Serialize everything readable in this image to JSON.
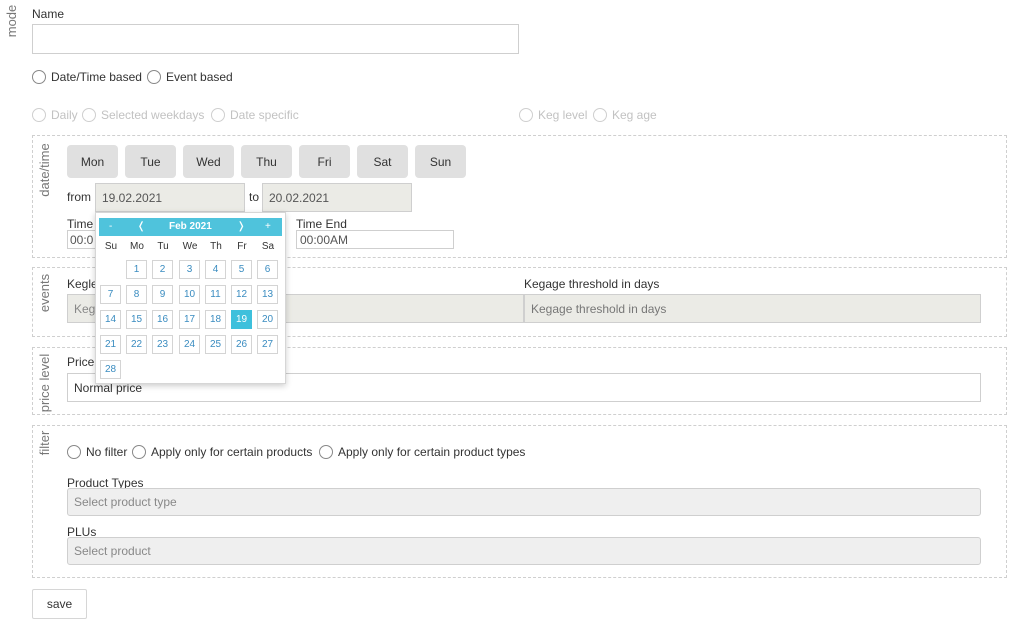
{
  "mode_label": "mode",
  "name": {
    "label": "Name",
    "value": ""
  },
  "mode_options": [
    {
      "label": "Date/Time based"
    },
    {
      "label": "Event based"
    }
  ],
  "schedule_options": [
    {
      "label": "Daily"
    },
    {
      "label": "Selected weekdays"
    },
    {
      "label": "Date specific"
    }
  ],
  "event_options": [
    {
      "label": "Keg level"
    },
    {
      "label": "Keg age"
    }
  ],
  "datetime": {
    "section_label": "date/time",
    "weekdays": [
      "Mon",
      "Tue",
      "Wed",
      "Thu",
      "Fri",
      "Sat",
      "Sun"
    ],
    "from_label": "from",
    "from_value": "19.02.2021",
    "to_label": "to",
    "to_value": "20.02.2021",
    "time_start_label": "Time",
    "time_start_value": "00:0",
    "time_end_label": "Time End",
    "time_end_value": "00:00AM"
  },
  "calendar": {
    "prev_year": "-",
    "prev_month": "❬",
    "month_label": "Feb 2021",
    "next_month": "❭",
    "next_year": "+",
    "weekday_headers": [
      "Su",
      "Mo",
      "Tu",
      "We",
      "Th",
      "Fr",
      "Sa"
    ],
    "first_weekday_index": 1,
    "days": [
      "1",
      "2",
      "3",
      "4",
      "5",
      "6",
      "7",
      "8",
      "9",
      "10",
      "11",
      "12",
      "13",
      "14",
      "15",
      "16",
      "17",
      "18",
      "19",
      "20",
      "21",
      "22",
      "23",
      "24",
      "25",
      "26",
      "27",
      "28"
    ],
    "selected_day": "19"
  },
  "events": {
    "section_label": "events",
    "keglevel_label": "Kegle",
    "keglevel_placeholder": "Keg",
    "kegage_label": "Kegage threshold in days",
    "kegage_placeholder": "Kegage threshold in days"
  },
  "price_level": {
    "section_label": "price level",
    "label": "Price",
    "value": "Normal price"
  },
  "filter": {
    "section_label": "filter",
    "options": [
      {
        "label": "No filter"
      },
      {
        "label": "Apply only for certain products"
      },
      {
        "label": "Apply only for certain product types"
      }
    ],
    "product_types_label": "Product Types",
    "product_types_placeholder": "Select product type",
    "plus_label": "PLUs",
    "plus_placeholder": "Select product"
  },
  "save_label": "save"
}
